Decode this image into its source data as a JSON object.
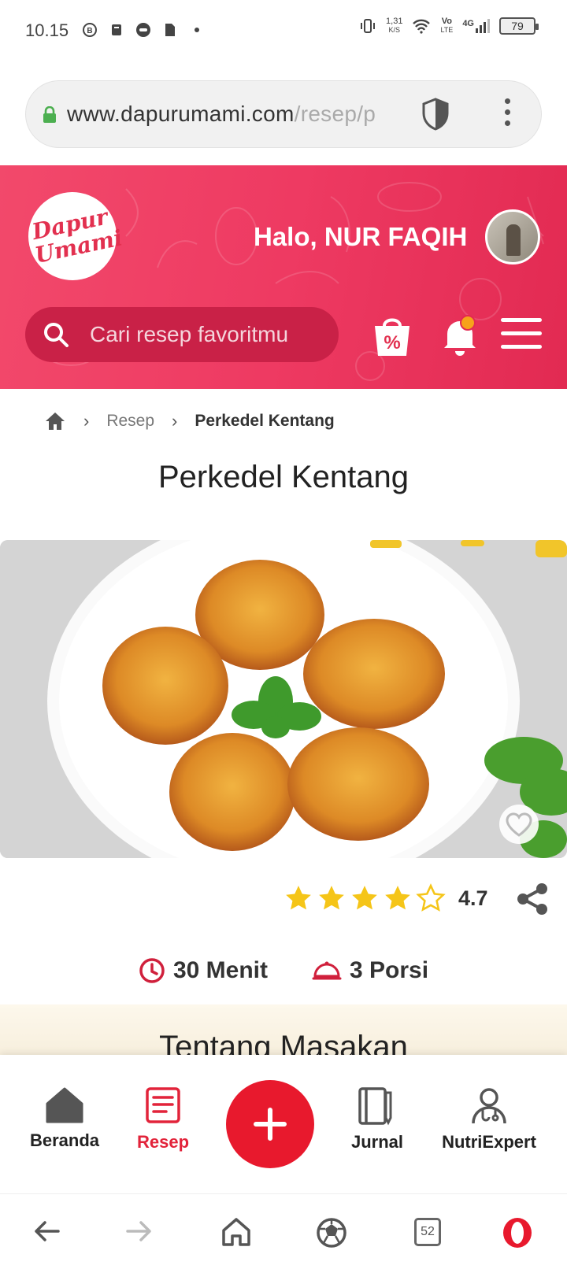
{
  "status_bar": {
    "time": "10.15",
    "net_speed": "1,31",
    "net_unit": "K/S",
    "volte": "Vo",
    "volte_sub": "LTE",
    "network": "4G",
    "battery": "79"
  },
  "browser": {
    "url_host": "www.dapurumami.com",
    "url_path": "/resep/p",
    "tab_count": "52"
  },
  "header": {
    "logo_line1": "Dapur",
    "logo_line2": "Umami",
    "greeting": "Halo, NUR FAQIH",
    "search_placeholder": "Cari resep favoritmu",
    "promo_symbol": "%"
  },
  "breadcrumb": {
    "items": [
      "Resep",
      "Perkedel Kentang"
    ]
  },
  "recipe": {
    "title": "Perkedel Kentang",
    "rating": 4.7,
    "rating_label": "4.7",
    "stars_filled": 4,
    "stars_total": 5,
    "time": "30 Menit",
    "portions": "3 Porsi",
    "section_title": "Tentang Masakan"
  },
  "bottom_nav": {
    "items": [
      "Beranda",
      "Resep",
      "Jurnal",
      "NutriExpert"
    ],
    "active": "Resep"
  },
  "colors": {
    "brand": "#ee3a62",
    "accent_red": "#e8192d",
    "star": "#f5c518"
  }
}
